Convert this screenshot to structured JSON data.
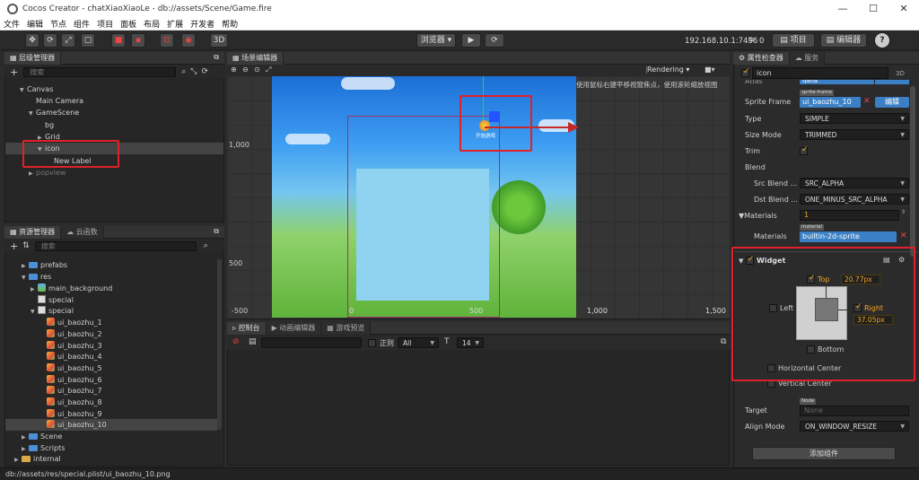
{
  "window": {
    "title": "Cocos Creator - chatXiaoXiaoLe - db://assets/Scene/Game.fire",
    "minimize": "—",
    "maximize": "☐",
    "close": "✕"
  },
  "menu": [
    "文件",
    "编辑",
    "节点",
    "组件",
    "项目",
    "面板",
    "布局",
    "扩展",
    "开发者",
    "帮助"
  ],
  "toolbar": {
    "mode_3d": "3D",
    "browser_label": "浏览器 ▾",
    "ip": "192.168.10.1:7456",
    "connections": "0",
    "project_btn": "项目",
    "editor_btn": "编辑器",
    "help_btn": "?"
  },
  "hierarchy": {
    "title": "层级管理器",
    "search_placeholder": "搜索",
    "nodes": [
      "Canvas",
      "Main Camera",
      "GameScene",
      "bg",
      "Grid",
      "icon",
      "New Label",
      "popview"
    ]
  },
  "assets": {
    "title": "资源管理器",
    "cloud_tab": "云函数",
    "search_placeholder": "搜索",
    "items": [
      "prefabs",
      "res",
      "main_background",
      "special",
      "special",
      "ui_baozhu_1",
      "ui_baozhu_2",
      "ui_baozhu_3",
      "ui_baozhu_4",
      "ui_baozhu_5",
      "ui_baozhu_6",
      "ui_baozhu_7",
      "ui_baozhu_8",
      "ui_baozhu_9",
      "ui_baozhu_10",
      "Scene",
      "Scripts",
      "internal"
    ]
  },
  "statusbar": "db://assets/res/special.plist/ui_baozhu_10.png",
  "scene": {
    "title": "场景编辑器",
    "rendering": "Rendering ▾",
    "hint": "使用鼠标右键平移视窗焦点，使用滚轮缩放视图",
    "ruler_y": [
      "1,000",
      "500",
      "-500"
    ],
    "ruler_x": [
      "0",
      "500",
      "1,000",
      "1,500"
    ],
    "icon_caption": "开始游戏"
  },
  "console": {
    "tabs": [
      "控制台",
      "动画编辑器",
      "游戏预览"
    ],
    "regex_label": "正则",
    "filter": "All",
    "font_size": "14"
  },
  "inspector": {
    "tabs": [
      "属性检查器",
      "服务"
    ],
    "node_name": "icon",
    "mode_3d": "3D",
    "partial_row": "Atlas",
    "partial_value": "special",
    "sprite_frame_label": "Sprite Frame",
    "sprite_frame_tag": "sprite-frame",
    "sprite_frame_value": "ui_baozhu_10",
    "edit_btn": "编辑",
    "type_label": "Type",
    "type_value": "SIMPLE",
    "size_mode_label": "Size Mode",
    "size_mode_value": "TRIMMED",
    "trim_label": "Trim",
    "blend_label": "Blend",
    "src_blend_label": "Src Blend ...",
    "src_blend_value": "SRC_ALPHA",
    "dst_blend_label": "Dst Blend ...",
    "dst_blend_value": "ONE_MINUS_SRC_ALPHA",
    "materials_label": "Materials",
    "materials_count": "1",
    "material_tag": "material",
    "materials_label2": "Materials",
    "material_value": "builtin-2d-sprite",
    "widget_title": "Widget",
    "top_label": "Top",
    "top_value": "20.77px",
    "right_label": "Right",
    "right_value": "37.05px",
    "left_label": "Left",
    "bottom_label": "Bottom",
    "hcenter_label": "Horizontal Center",
    "vcenter_label": "Vertical Center",
    "node_tag": "Node",
    "target_label": "Target",
    "target_value": "None",
    "align_mode_label": "Align Mode",
    "align_mode_value": "ON_WINDOW_RESIZE",
    "add_component": "添加组件"
  },
  "colors": {
    "accent": "#3b7fc4",
    "highlight": "#e0202a",
    "check": "#f5a623"
  }
}
